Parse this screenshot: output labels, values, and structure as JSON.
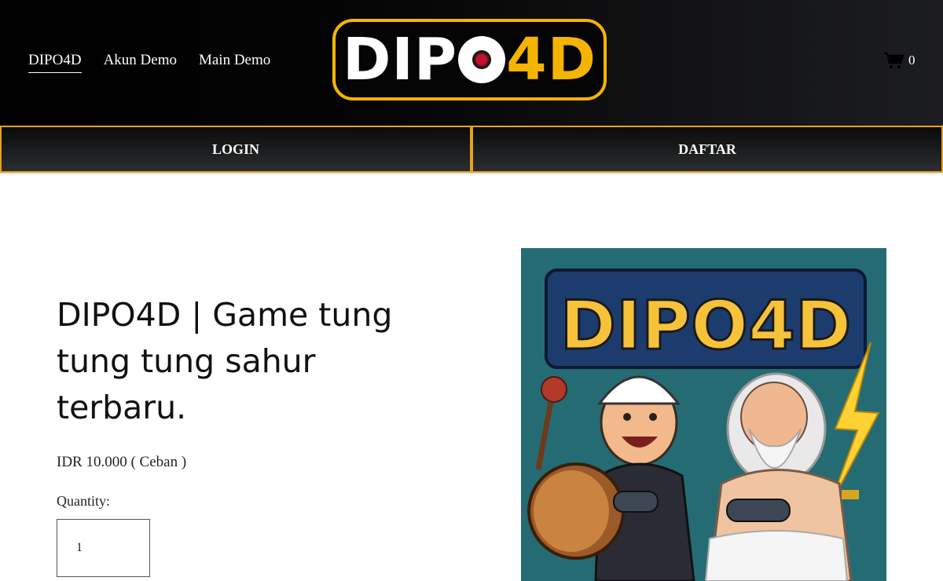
{
  "nav": {
    "items": [
      {
        "label": "DIPO4D",
        "active": true
      },
      {
        "label": "Akun Demo",
        "active": false
      },
      {
        "label": "Main Demo",
        "active": false
      }
    ]
  },
  "logo": {
    "part1": "DIP",
    "part2": "4D"
  },
  "cart": {
    "icon": "cart-icon",
    "count": "0"
  },
  "buttons": {
    "login": "LOGIN",
    "daftar": "DAFTAR"
  },
  "product": {
    "title": "DIPO4D | Game tung tung tung sahur terbaru.",
    "price": "IDR 10.000 ( Ceban )",
    "quantity_label": "Quantity:",
    "quantity_value": "1",
    "image_banner": "DIPO4D"
  },
  "colors": {
    "accent": "#f5b400",
    "header_bg": "#000000",
    "image_bg": "#256b74"
  }
}
